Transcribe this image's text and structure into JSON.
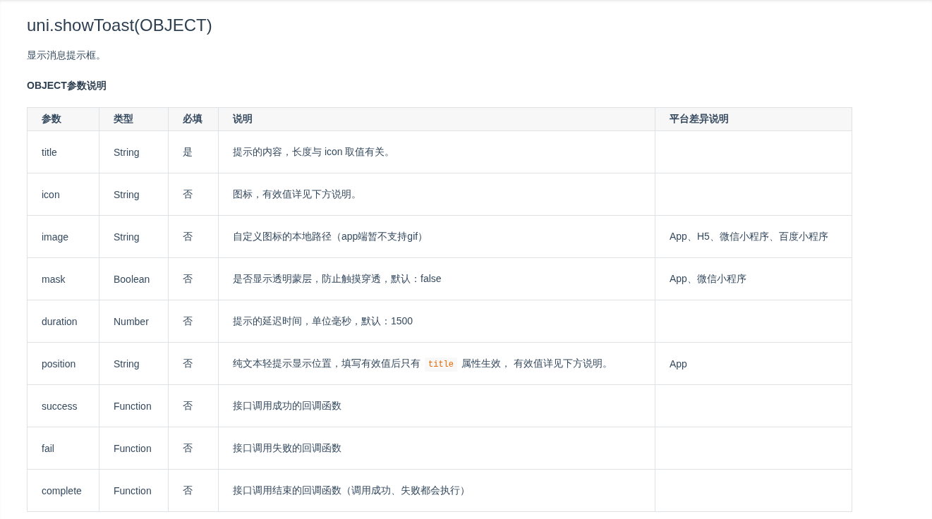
{
  "heading": "uni.showToast(OBJECT)",
  "intro": "显示消息提示框。",
  "section_title": "OBJECT参数说明",
  "table": {
    "columns": [
      "参数",
      "类型",
      "必填",
      "说明",
      "平台差异说明"
    ],
    "rows": [
      {
        "param": "title",
        "type": "String",
        "required": "是",
        "description": [
          {
            "kind": "text",
            "text": "提示的内容，长度与 icon 取值有关。"
          }
        ]
      },
      {
        "param": "icon",
        "type": "String",
        "required": "否",
        "description": [
          {
            "kind": "text",
            "text": "图标，有效值详见下方说明。"
          }
        ]
      },
      {
        "param": "image",
        "type": "String",
        "required": "否",
        "description": [
          {
            "kind": "text",
            "text": "自定义图标的本地路径（app端暂不支持gif）"
          }
        ],
        "platform": "App、H5、微信小程序、百度小程序"
      },
      {
        "param": "mask",
        "type": "Boolean",
        "required": "否",
        "description": [
          {
            "kind": "text",
            "text": "是否显示透明蒙层，防止触摸穿透，默认：false"
          }
        ],
        "platform": "App、微信小程序"
      },
      {
        "param": "duration",
        "type": "Number",
        "required": "否",
        "description": [
          {
            "kind": "text",
            "text": "提示的延迟时间，单位毫秒，默认：1500"
          }
        ]
      },
      {
        "param": "position",
        "type": "String",
        "required": "否",
        "description": [
          {
            "kind": "text",
            "text": "纯文本轻提示显示位置，填写有效值后只有"
          },
          {
            "kind": "code",
            "text": "title"
          },
          {
            "kind": "text",
            "text": "属性生效， 有效值详见下方说明。"
          }
        ],
        "platform": "App"
      },
      {
        "param": "success",
        "type": "Function",
        "required": "否",
        "description": [
          {
            "kind": "text",
            "text": "接口调用成功的回调函数"
          }
        ]
      },
      {
        "param": "fail",
        "type": "Function",
        "required": "否",
        "description": [
          {
            "kind": "text",
            "text": "接口调用失败的回调函数"
          }
        ]
      },
      {
        "param": "complete",
        "type": "Function",
        "required": "否",
        "description": [
          {
            "kind": "text",
            "text": "接口调用结束的回调函数（调用成功、失败都会执行）"
          }
        ]
      }
    ]
  }
}
